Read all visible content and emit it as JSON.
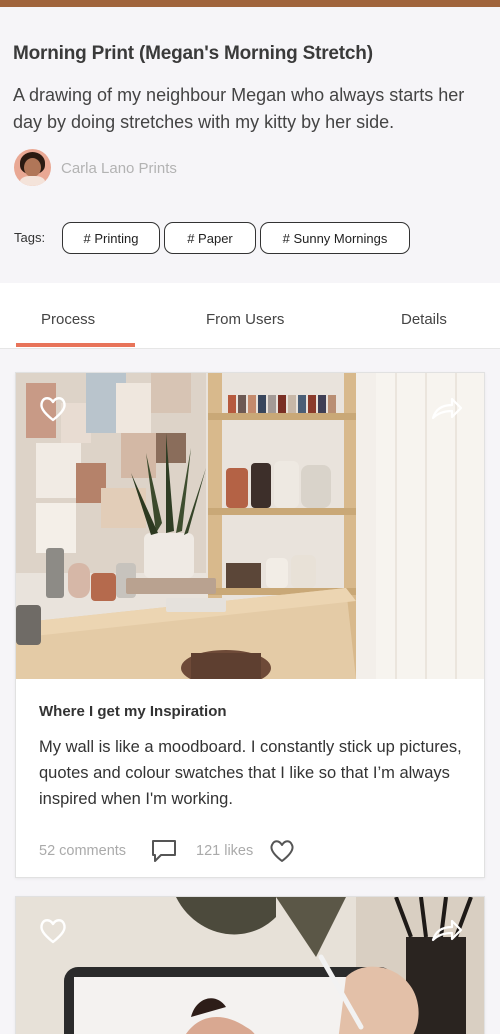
{
  "post": {
    "title": "Morning Print (Megan's Morning Stretch)",
    "description": "A drawing of my neighbour Megan who always starts her day by doing stretches with my kitty by her side.",
    "author": "Carla Lano Prints",
    "tags_label": "Tags:",
    "tags": [
      "# Printing",
      "# Paper",
      "# Sunny Mornings"
    ]
  },
  "tabs": [
    {
      "label": "Process",
      "active": true
    },
    {
      "label": "From Users",
      "active": false
    },
    {
      "label": "Details",
      "active": false
    }
  ],
  "cards": [
    {
      "title": "Where I get my Inspiration",
      "text": "My wall is like a moodboard. I constantly stick up pictures, quotes and colour swatches that I like so that I’m always inspired when I'm working.",
      "comments": "52 comments",
      "likes": "121 likes"
    }
  ],
  "colors": {
    "accent": "#e8745a",
    "top_bar": "#a0643c",
    "background": "#f6f5f8"
  },
  "icons": [
    "heart-icon",
    "share-arrow-icon",
    "comment-icon",
    "like-heart-icon"
  ]
}
